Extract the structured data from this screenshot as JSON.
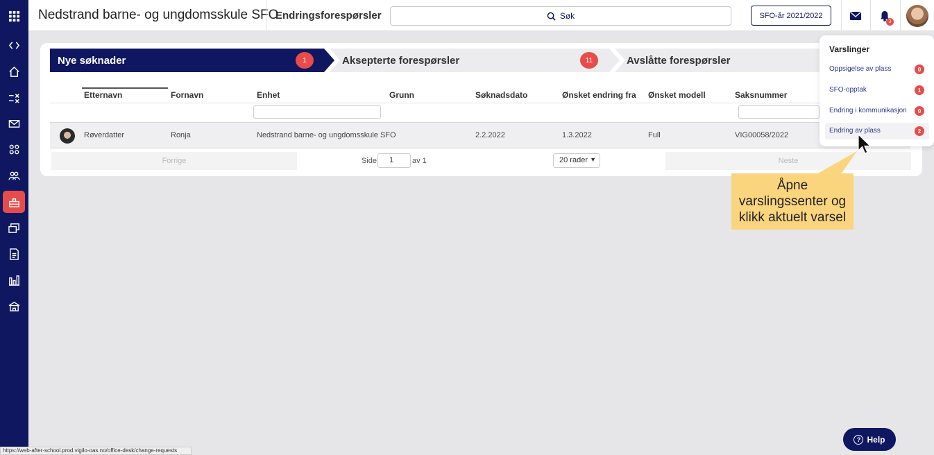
{
  "sidebar": {
    "items": [
      {
        "name": "apps-grid-icon"
      },
      {
        "name": "expand-collapse-icon"
      },
      {
        "name": "home-icon"
      },
      {
        "name": "tasks-icon"
      },
      {
        "name": "mail-icon"
      },
      {
        "name": "groups-icon"
      },
      {
        "name": "children-icon"
      },
      {
        "name": "office-desk-icon",
        "active": true
      },
      {
        "name": "finance-icon"
      },
      {
        "name": "document-icon"
      },
      {
        "name": "statistics-icon"
      },
      {
        "name": "school-icon"
      }
    ]
  },
  "topbar": {
    "school_name": "Nedstrand barne- og ungdomsskule SFO",
    "page_title": "Endringsforespørsler",
    "search_placeholder": "Søk",
    "year_button": "SFO-år 2021/2022",
    "notification_count": "3"
  },
  "tabs": [
    {
      "label": "Nye søknader",
      "badge": "1",
      "active": true
    },
    {
      "label": "Aksepterte forespørsler",
      "badge": "11"
    },
    {
      "label": "Avslåtte forespørsler"
    }
  ],
  "table": {
    "columns": [
      "Etternavn",
      "Fornavn",
      "Enhet",
      "Grunn",
      "Søknadsdato",
      "Ønsket endring fra",
      "Ønsket modell",
      "Saksnummer"
    ],
    "rows": [
      {
        "etternavn": "Røverdatter",
        "fornavn": "Ronja",
        "enhet": "Nedstrand barne- og ungdomsskule SFO",
        "grunn": "",
        "soknadsdato": "2.2.2022",
        "endring_fra": "1.3.2022",
        "modell": "Full",
        "saksnummer": "VIG00058/2022"
      }
    ]
  },
  "pager": {
    "prev": "Forrige",
    "page_label": "Side",
    "page": "1",
    "of": "av 1",
    "rows_option": "20 rader",
    "next": "Neste"
  },
  "notifications": {
    "title": "Varslinger",
    "items": [
      {
        "label": "Oppsigelse av plass",
        "count": "0"
      },
      {
        "label": "SFO-opptak",
        "count": "1"
      },
      {
        "label": "Endring i kommunikasjon",
        "count": "0"
      },
      {
        "label": "Endring av plass",
        "count": "2",
        "highlighted": true
      }
    ]
  },
  "callout": {
    "line1": "Åpne",
    "line2": "varslingssenter og",
    "line3": "klikk aktuelt varsel"
  },
  "help_label": "Help",
  "status_url": "https://web-after-school.prod.vigilo-oas.no/office-desk/change-requests",
  "colors": {
    "navy": "#0f1760",
    "accent_red": "#e74c4a",
    "callout": "#fbd57e"
  }
}
